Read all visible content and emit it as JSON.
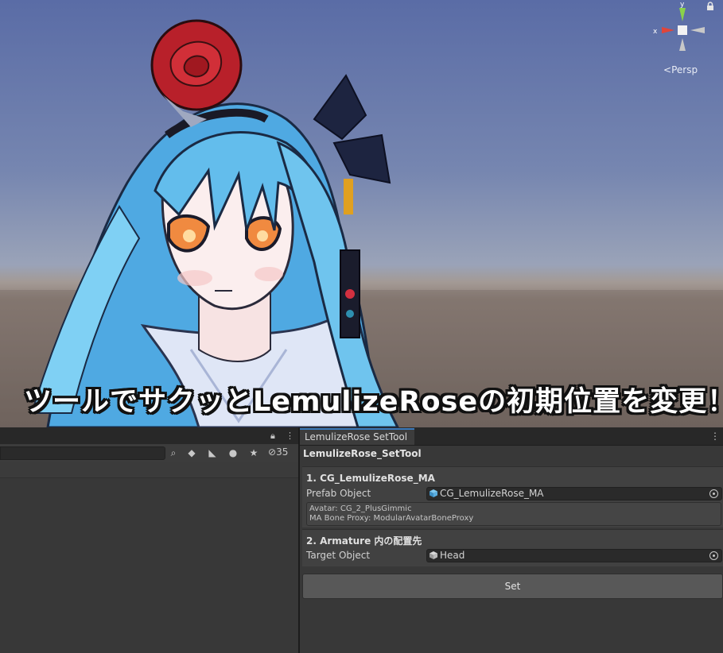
{
  "scene": {
    "view_mode": "Persp",
    "axis_x": "x",
    "axis_y": "y",
    "caption": "ツールでサクッとLemulizeRoseの初期位置を変更！"
  },
  "hierarchy": {
    "visible_count": "35"
  },
  "tool_window": {
    "tab_label": "LemulizeRose SetTool",
    "title": "LemulizeRose_SetTool",
    "section1": {
      "title": "1. CG_LemulizeRose_MA",
      "prefab_label": "Prefab Object",
      "prefab_value": "CG_LemulizeRose_MA",
      "info_avatar": "Avatar: CG_2_PlusGimmic",
      "info_proxy": "MA Bone Proxy: ModularAvatarBoneProxy"
    },
    "section2": {
      "title": "2. Armature 内の配置先",
      "target_label": "Target Object",
      "target_value": "Head"
    },
    "set_label": "Set"
  },
  "colors": {
    "accent": "#3a79bb",
    "panel_bg": "#383838",
    "hair": "#6fc4ee",
    "rose": "#c4232c"
  }
}
